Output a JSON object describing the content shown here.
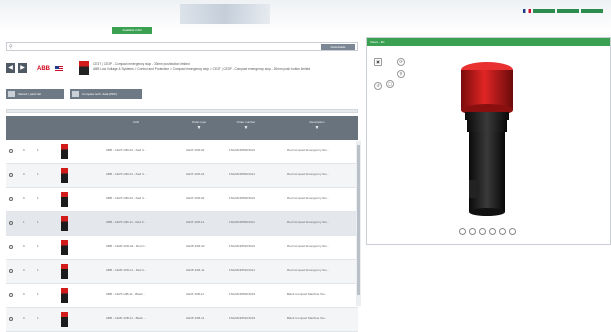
{
  "top": {
    "button_label": "Available CAD"
  },
  "search": {
    "icon": "search-icon",
    "placeholder": "",
    "button_label": "Downloads"
  },
  "product": {
    "brand": "ABB",
    "title_line1": "CE3T | CE3P - Compact emergency stop - 30mm pushbutton limited",
    "title_line2": "ABB Low Voltage & Systems  >  Control and Protection  >  Compact emergency stop  >  CE3T | CE3P - Compact emergency stop - 30mm push button limited"
  },
  "actions": {
    "select_variant": "Variant / parts list",
    "compare": "Compare tech. data (PDF)"
  },
  "table": {
    "headers": [
      "",
      "",
      "",
      "CAD",
      "Order type",
      "Name",
      "Order number",
      "Description"
    ],
    "rows": [
      {
        "a": "0",
        "b": "1",
        "name": "ABB - CE3T-10R-02 - Red C...",
        "order": "CE3T-10R-02",
        "num": "1SFA619550R1021",
        "desc": "Red Compact Emergency Sto..."
      },
      {
        "a": "0",
        "b": "1",
        "name": "ABB - CE3T-10R-01 - Red C...",
        "order": "CE3T-10R-01",
        "num": "1SFA619550R1011",
        "desc": "Red Compact Emergency Sto..."
      },
      {
        "a": "0",
        "b": "1",
        "name": "ABB - CE3T-10R-02 - Red C...",
        "order": "CE3T-10R-02",
        "num": "1SFA619550R1021",
        "desc": "Red Compact Emergency Sto..."
      },
      {
        "a": "1",
        "b": "1",
        "name": "ABB - CE3T-10R-11 - Red C...",
        "order": "CE3T-10R-11",
        "num": "1SFA619550R1011",
        "desc": "Red Compact Emergency Sto..."
      },
      {
        "a": "0",
        "b": "1",
        "name": "ABB - CE3P-10R-02 - Red C...",
        "order": "CE3P-10R-02",
        "num": "1SFA619551R1021",
        "desc": "Red Compact Emergency Sto..."
      },
      {
        "a": "0",
        "b": "1",
        "name": "ABB - CE3P-10R-11 - Red C...",
        "order": "CE3P-10R-11",
        "num": "1SFA619551R1011",
        "desc": "Red Compact Emergency Sto..."
      },
      {
        "a": "0",
        "b": "1",
        "name": "ABB - CE3T-10B-11 - Black ...",
        "order": "CE3T-10B-11",
        "num": "1SFA619550R1019",
        "desc": "Black Compact Machine Sto..."
      },
      {
        "a": "0",
        "b": "1",
        "name": "ABB - CE3P-10B-11 - Black ...",
        "order": "CE3P-10B-11",
        "num": "1SFA619551R1019",
        "desc": "Black Compact Machine Sto..."
      }
    ]
  },
  "viewer": {
    "title": "Views - 3D"
  },
  "colors": {
    "green": "#3aa152",
    "header_gray": "#68737e",
    "red": "#d21c1c"
  }
}
